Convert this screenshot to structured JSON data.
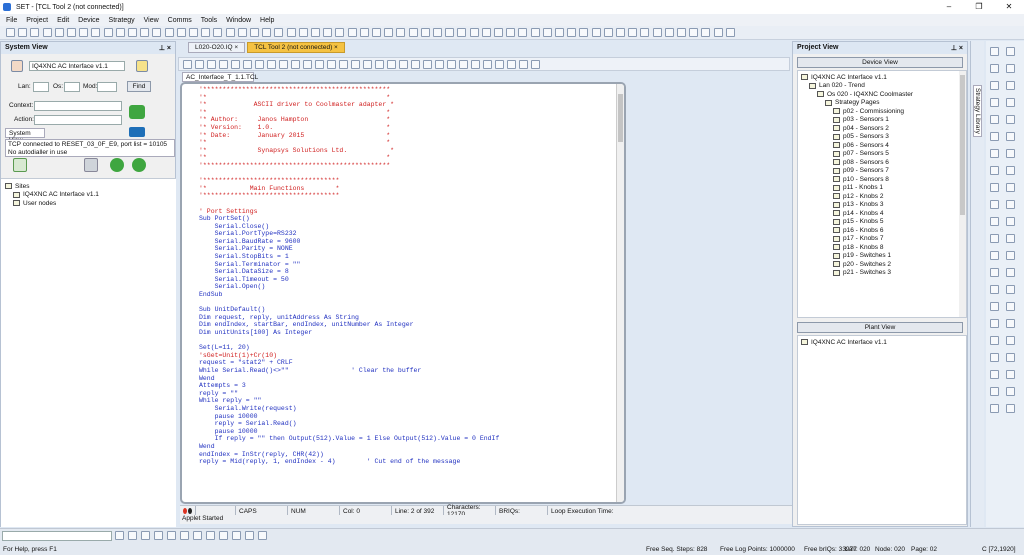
{
  "window": {
    "title": "SET - [TCL Tool 2 (not connected)]"
  },
  "menu": [
    "File",
    "Project",
    "Edit",
    "Device",
    "Strategy",
    "View",
    "Comms",
    "Tools",
    "Window",
    "Help"
  ],
  "system_view": {
    "title": "System View",
    "pin": "⊥ ×",
    "device_select": "IQ4XNC AC Interface v1.1",
    "lan_label": "Lan:",
    "os_label": "Os:",
    "mod_label": "Mod:",
    "find_label": "Find",
    "context_label": "Context:",
    "action_label": "Action:",
    "tab": "System View",
    "status_line1": "TCP connected to RESET_03_0F_E9, port list = 10105",
    "status_line2": "No autodialler in use",
    "tree": [
      {
        "label": "Sites",
        "indent": 0
      },
      {
        "label": "IQ4XNC AC Interface v1.1",
        "indent": 1
      },
      {
        "label": "User nodes",
        "indent": 1
      }
    ]
  },
  "doc_tabs": [
    {
      "label": "L020-O20.IQ",
      "active": false
    },
    {
      "label": "TCL Tool 2 (not connected)",
      "active": true
    }
  ],
  "editor": {
    "file_tab": "AC_Interface_T_1.1.TCL",
    "lines": [
      {
        "t": "'************************************************",
        "c": "red"
      },
      {
        "t": "'*                                              *",
        "c": "red"
      },
      {
        "t": "'*            ASCII driver to Coolmaster adapter *",
        "c": "red"
      },
      {
        "t": "'*                                              *",
        "c": "red"
      },
      {
        "t": "'* Author:     Janos Hampton                    *",
        "c": "red"
      },
      {
        "t": "'* Version:    1.0.                             *",
        "c": "red"
      },
      {
        "t": "'* Date:       January 2015                     *",
        "c": "red"
      },
      {
        "t": "'*                                              *",
        "c": "red"
      },
      {
        "t": "'*             Synapsys Solutions Ltd.           *",
        "c": "red"
      },
      {
        "t": "'*                                              *",
        "c": "red"
      },
      {
        "t": "'************************************************",
        "c": "red"
      },
      {
        "t": "",
        "c": "blue"
      },
      {
        "t": "'***********************************",
        "c": "red"
      },
      {
        "t": "'*           Main Functions        *",
        "c": "red"
      },
      {
        "t": "'***********************************",
        "c": "red"
      },
      {
        "t": "",
        "c": "blue"
      },
      {
        "t": "' Port Settings",
        "c": "red"
      },
      {
        "t": "Sub PortSet()",
        "c": "blue"
      },
      {
        "t": "    Serial.Close()",
        "c": "blue"
      },
      {
        "t": "    Serial.PortType=RS232",
        "c": "blue"
      },
      {
        "t": "    Serial.BaudRate = 9600",
        "c": "blue"
      },
      {
        "t": "    Serial.Parity = NONE",
        "c": "blue"
      },
      {
        "t": "    Serial.StopBits = 1",
        "c": "blue"
      },
      {
        "t": "    Serial.Terminator = \"\"",
        "c": "blue"
      },
      {
        "t": "    Serial.DataSize = 8",
        "c": "blue"
      },
      {
        "t": "    Serial.Timeout = 50",
        "c": "blue"
      },
      {
        "t": "    Serial.Open()",
        "c": "blue"
      },
      {
        "t": "EndSub",
        "c": "blue"
      },
      {
        "t": "",
        "c": "blue"
      },
      {
        "t": "Sub UnitDefault()",
        "c": "blue"
      },
      {
        "t": "Dim request, reply, unitAddress As String",
        "c": "blue"
      },
      {
        "t": "Dim endIndex, startBar, endIndex, unitNumber As Integer",
        "c": "blue"
      },
      {
        "t": "Dim unitUnits[100] As Integer",
        "c": "blue"
      },
      {
        "t": "",
        "c": "blue"
      },
      {
        "t": "Set(L=11, 20)",
        "c": "blue"
      },
      {
        "t": "'sGet=Unit(1)+Cr(10)",
        "c": "red"
      },
      {
        "t": "request = \"stat2\" + CRLF",
        "c": "blue"
      },
      {
        "t": "While Serial.Read()<>\"\"                ' Clear the buffer",
        "c": "blue"
      },
      {
        "t": "Wend",
        "c": "blue"
      },
      {
        "t": "Attempts = 3",
        "c": "blue"
      },
      {
        "t": "reply = \"\"",
        "c": "blue"
      },
      {
        "t": "While reply = \"\"",
        "c": "blue"
      },
      {
        "t": "    Serial.Write(request)",
        "c": "blue"
      },
      {
        "t": "    pause 10000",
        "c": "blue"
      },
      {
        "t": "    reply = Serial.Read()",
        "c": "blue"
      },
      {
        "t": "    pause 10000",
        "c": "blue"
      },
      {
        "t": "    If reply = \"\" then Output(512).Value = 1 Else Output(512).Value = 0 EndIf",
        "c": "blue"
      },
      {
        "t": "Wend",
        "c": "blue"
      },
      {
        "t": "endIndex = InStr(reply, CHR(42))",
        "c": "blue"
      },
      {
        "t": "reply = Mid(reply, 1, endIndex - 4)        ' Cut end of the message",
        "c": "blue"
      }
    ]
  },
  "editor_status": {
    "caps": "CAPS",
    "num": "NUM",
    "col": "Col: 0",
    "line": "Line: 2 of 392",
    "chars": "Characters: 12170",
    "briqs": "BRIQs:",
    "exec": "Loop Execution Time:"
  },
  "applet_status": "Applet Started",
  "project_view": {
    "title": "Project View",
    "device_view_label": "Device View",
    "plant_view_label": "Plant View",
    "device_tree": [
      {
        "label": "IQ4XNC AC Interface v1.1",
        "indent": 0
      },
      {
        "label": "Lan 020 - Trend",
        "indent": 1
      },
      {
        "label": "Os 020 - IQ4XNC Coolmaster",
        "indent": 2
      },
      {
        "label": "Strategy Pages",
        "indent": 3
      },
      {
        "label": "p02 - Commissioning",
        "indent": 4
      },
      {
        "label": "p03 - Sensors 1",
        "indent": 4
      },
      {
        "label": "p04 - Sensors 2",
        "indent": 4
      },
      {
        "label": "p05 - Sensors 3",
        "indent": 4
      },
      {
        "label": "p06 - Sensors 4",
        "indent": 4
      },
      {
        "label": "p07 - Sensors 5",
        "indent": 4
      },
      {
        "label": "p08 - Sensors 6",
        "indent": 4
      },
      {
        "label": "p09 - Sensors 7",
        "indent": 4
      },
      {
        "label": "p10 - Sensors 8",
        "indent": 4
      },
      {
        "label": "p11 - Knobs 1",
        "indent": 4
      },
      {
        "label": "p12 - Knobs 2",
        "indent": 4
      },
      {
        "label": "p13 - Knobs 3",
        "indent": 4
      },
      {
        "label": "p14 - Knobs 4",
        "indent": 4
      },
      {
        "label": "p15 - Knobs 5",
        "indent": 4
      },
      {
        "label": "p16 - Knobs 6",
        "indent": 4
      },
      {
        "label": "p17 - Knobs 7",
        "indent": 4
      },
      {
        "label": "p18 - Knobs 8",
        "indent": 4
      },
      {
        "label": "p19 - Switches 1",
        "indent": 4
      },
      {
        "label": "p20 - Switches 2",
        "indent": 4
      },
      {
        "label": "p21 - Switches 3",
        "indent": 4
      }
    ],
    "plant_tree": [
      {
        "label": "IQ4XNC AC Interface v1.1",
        "indent": 0
      }
    ]
  },
  "strategy_library": "Strategy Library",
  "bottom_status": {
    "help": "For Help, press F1",
    "seq": "Free Seq. Steps: 828",
    "log": "Free Log Points: 1000000",
    "briqs": "Free brIQs: 33977",
    "lan": "Lan: 020",
    "node": "Node: 020",
    "page": "Page: 02",
    "coord": "C [72,1920]"
  },
  "colors": {
    "accent": "#f5c242",
    "panel_header": "#dde7f3",
    "code_red": "#d02020",
    "code_blue": "#2030c0"
  }
}
